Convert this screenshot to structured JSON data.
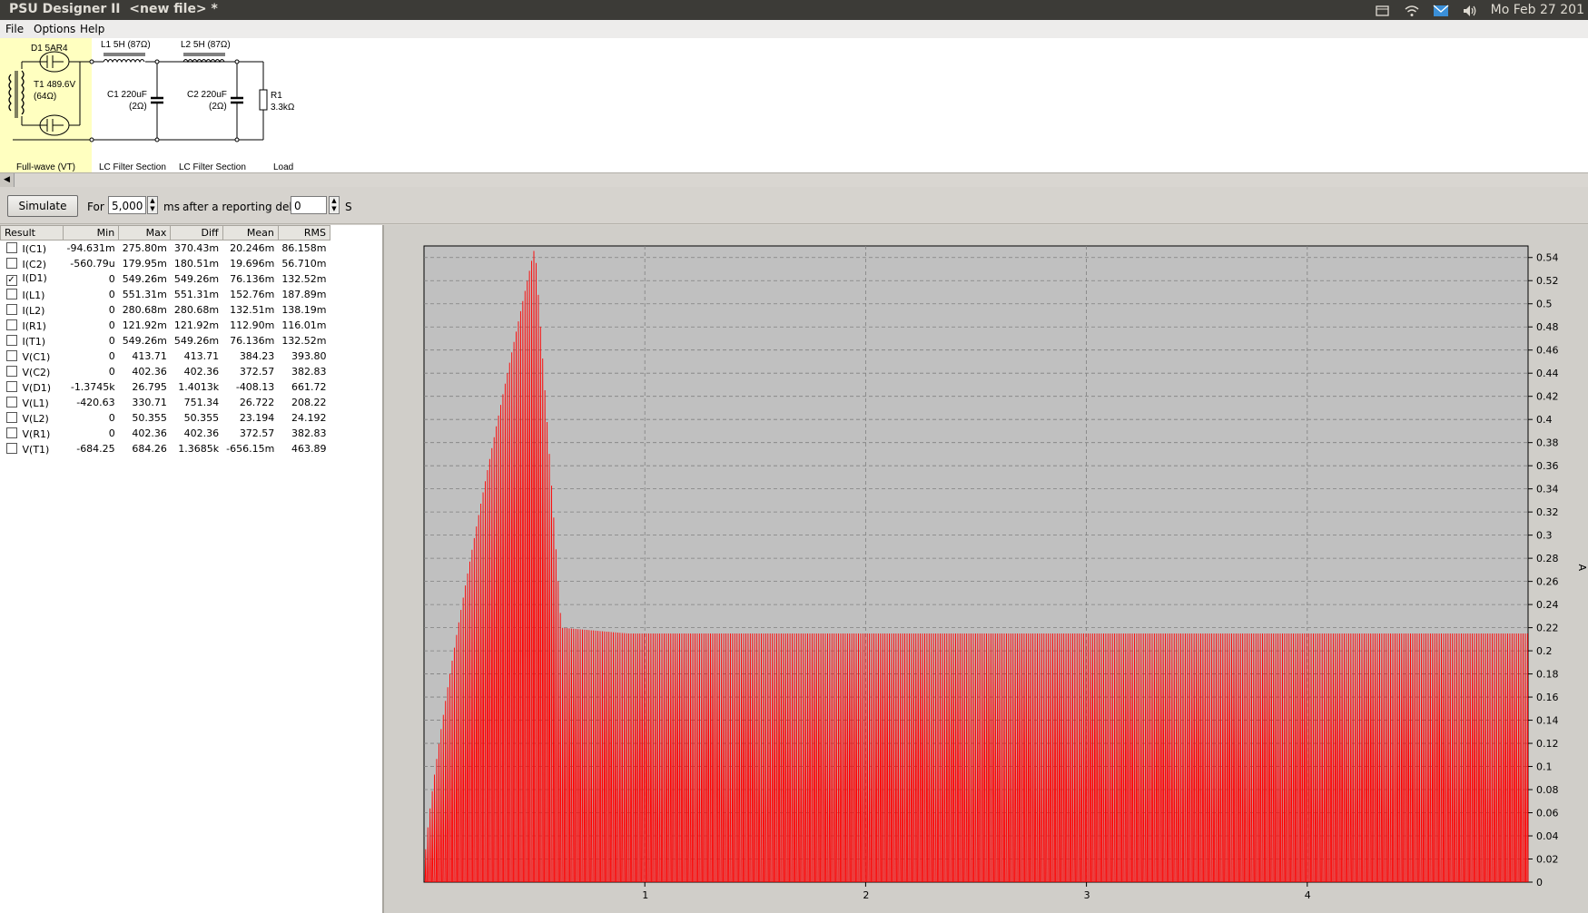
{
  "topbar": {
    "title": "PSU Designer II  <new file> *",
    "clock": "Mo Feb 27 201",
    "icons": [
      "window-icon",
      "wifi-icon",
      "mail-icon",
      "volume-icon"
    ]
  },
  "menu": {
    "file": "File",
    "options": "Options",
    "help": "Help"
  },
  "schematic": {
    "rectifier_tube": "D1 5AR4",
    "transformer": "T1 489.6V",
    "transformer_r": "(64Ω)",
    "rectifier_section": "Full-wave (VT)",
    "l1": "L1 5H (87Ω)",
    "c1": "C1 220uF",
    "c1_r": "(2Ω)",
    "section1": "LC Filter Section",
    "l2": "L2 5H (87Ω)",
    "c2": "C2 220uF",
    "c2_r": "(2Ω)",
    "section2": "LC Filter Section",
    "r1": "R1",
    "r1_val": "3.3kΩ",
    "load": "Load",
    "highlight_color": "#ffffc0"
  },
  "simbar": {
    "simulate": "Simulate",
    "for": "For",
    "duration": "5,000",
    "ms": "ms",
    "delay_label": "after a reporting delay of",
    "delay": "0",
    "s": "S"
  },
  "table": {
    "headers": [
      "Result",
      "Min",
      "Max",
      "Diff",
      "Mean",
      "RMS"
    ],
    "rows": [
      {
        "name": "I(C1)",
        "checked": false,
        "min": "-94.631m",
        "max": "275.80m",
        "diff": "370.43m",
        "mean": "20.246m",
        "rms": "86.158m"
      },
      {
        "name": "I(C2)",
        "checked": false,
        "min": "-560.79u",
        "max": "179.95m",
        "diff": "180.51m",
        "mean": "19.696m",
        "rms": "56.710m"
      },
      {
        "name": "I(D1)",
        "checked": true,
        "min": "0",
        "max": "549.26m",
        "diff": "549.26m",
        "mean": "76.136m",
        "rms": "132.52m"
      },
      {
        "name": "I(L1)",
        "checked": false,
        "min": "0",
        "max": "551.31m",
        "diff": "551.31m",
        "mean": "152.76m",
        "rms": "187.89m"
      },
      {
        "name": "I(L2)",
        "checked": false,
        "min": "0",
        "max": "280.68m",
        "diff": "280.68m",
        "mean": "132.51m",
        "rms": "138.19m"
      },
      {
        "name": "I(R1)",
        "checked": false,
        "min": "0",
        "max": "121.92m",
        "diff": "121.92m",
        "mean": "112.90m",
        "rms": "116.01m"
      },
      {
        "name": "I(T1)",
        "checked": false,
        "min": "0",
        "max": "549.26m",
        "diff": "549.26m",
        "mean": "76.136m",
        "rms": "132.52m"
      },
      {
        "name": "V(C1)",
        "checked": false,
        "min": "0",
        "max": "413.71",
        "diff": "413.71",
        "mean": "384.23",
        "rms": "393.80"
      },
      {
        "name": "V(C2)",
        "checked": false,
        "min": "0",
        "max": "402.36",
        "diff": "402.36",
        "mean": "372.57",
        "rms": "382.83"
      },
      {
        "name": "V(D1)",
        "checked": false,
        "min": "-1.3745k",
        "max": "26.795",
        "diff": "1.4013k",
        "mean": "-408.13",
        "rms": "661.72"
      },
      {
        "name": "V(L1)",
        "checked": false,
        "min": "-420.63",
        "max": "330.71",
        "diff": "751.34",
        "mean": "26.722",
        "rms": "208.22"
      },
      {
        "name": "V(L2)",
        "checked": false,
        "min": "0",
        "max": "50.355",
        "diff": "50.355",
        "mean": "23.194",
        "rms": "24.192"
      },
      {
        "name": "V(R1)",
        "checked": false,
        "min": "0",
        "max": "402.36",
        "diff": "402.36",
        "mean": "372.57",
        "rms": "382.83"
      },
      {
        "name": "V(T1)",
        "checked": false,
        "min": "-684.25",
        "max": "684.26",
        "diff": "1.3685k",
        "mean": "-656.15m",
        "rms": "463.89"
      }
    ]
  },
  "chart_data": {
    "type": "line",
    "series": [
      {
        "name": "",
        "description_values": {
          "peak": 0.549,
          "steady_peak": 0.215,
          "steady_trough_hi": 0.12,
          "steady_trough_lo": 0.03
        }
      }
    ],
    "x_ticks": [
      "1",
      "2",
      "3",
      "4"
    ],
    "xlim": [
      0,
      5
    ],
    "y_ticks": [
      "0",
      "0.02",
      "0.04",
      "0.06",
      "0.08",
      "0.1",
      "0.12",
      "0.14",
      "0.16",
      "0.18",
      "0.2",
      "0.22",
      "0.24",
      "0.26",
      "0.28",
      "0.3",
      "0.32",
      "0.34",
      "0.36",
      "0.38",
      "0.4",
      "0.42",
      "0.44",
      "0.46",
      "0.48",
      "0.5",
      "0.52",
      "0.54"
    ],
    "ylim": [
      0,
      0.55
    ],
    "ylabel": "A",
    "trace_color": "#ff0000",
    "grid": true,
    "plot_bg": "#c0c0c0"
  }
}
